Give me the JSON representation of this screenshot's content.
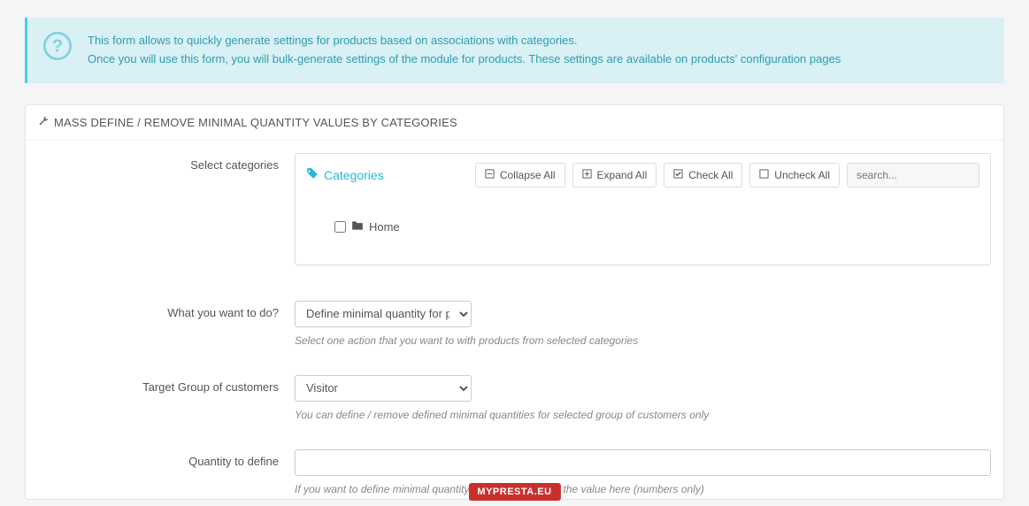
{
  "banner": {
    "line1": "This form allows to quickly generate settings for products based on associations with categories.",
    "line2": "Once you will use this form, you will bulk-generate settings of the module for products. These settings are available on products' configuration pages"
  },
  "panel": {
    "title": "MASS DEFINE / REMOVE MINIMAL QUANTITY VALUES BY CATEGORIES"
  },
  "categories": {
    "label": "Select categories",
    "heading": "Categories",
    "collapse": "Collapse All",
    "expand": "Expand All",
    "check": "Check All",
    "uncheck": "Uncheck All",
    "search_placeholder": "search...",
    "root": "Home"
  },
  "action": {
    "label": "What you want to do?",
    "selected": "Define minimal quantity for p",
    "help": "Select one action that you want to with products from selected categories"
  },
  "group": {
    "label": "Target Group of customers",
    "selected": "Visitor",
    "help": "You can define / remove defined minimal quantities for selected group of customers only"
  },
  "qty": {
    "label": "Quantity to define",
    "help": "If you want to define minimal quantity restrictions just set the value here (numbers only)"
  },
  "footer": "MYPRESTA.EU"
}
